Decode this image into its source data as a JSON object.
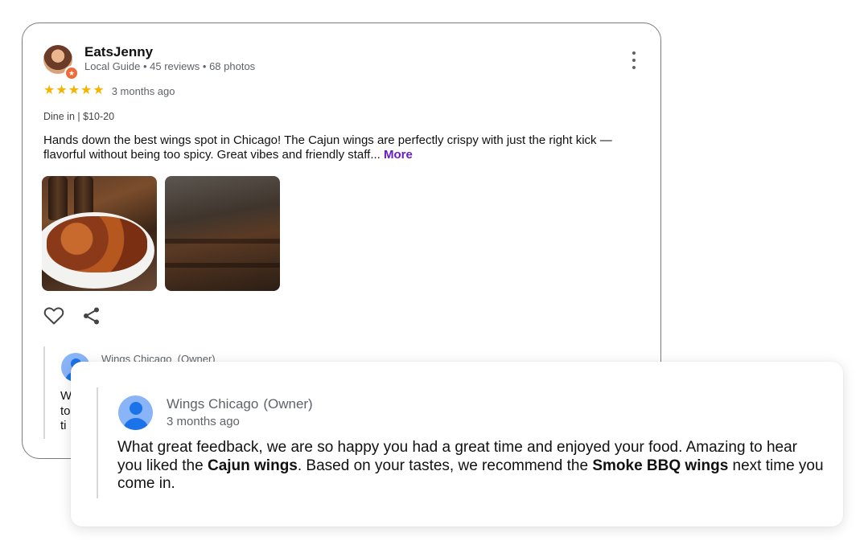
{
  "review": {
    "user_name": "EatsJenny",
    "user_meta": "Local Guide • 45 reviews • 68 photos",
    "rating": 5,
    "stars": [
      "★",
      "★",
      "★",
      "★",
      "★"
    ],
    "time": "3 months ago",
    "dine_info": "Dine in | $10-20",
    "text": "Hands down the best wings spot in Chicago! The Cajun wings are perfectly crispy with just the right kick — flavorful without being too spicy. Great vibes and friendly staff...",
    "more_label": "More",
    "photos": [
      "wings-photo",
      "restaurant-interior-photo"
    ],
    "icons": [
      "kebab-menu-icon",
      "heart-icon",
      "share-icon"
    ]
  },
  "owner_reply_preview": {
    "owner_name": "Wings Chicago",
    "owner_tag": "(Owner)",
    "visible_letters": [
      "W",
      "to",
      "ti"
    ]
  },
  "owner_reply": {
    "owner_name": "Wings Chicago",
    "owner_tag": "(Owner)",
    "time": "3 months ago",
    "text_1": "What great feedback, we are so happy you had a great time and enjoyed your food. Amazing to hear you liked the ",
    "bold_1": "Cajun wings",
    "text_2": ". Based on your tastes, we recommend the ",
    "bold_2": "Smoke BBQ wings",
    "text_3": " next time you come in."
  },
  "colors": {
    "star": "#f4b400",
    "more_link": "#6a1cc4",
    "avatar_blue": "#1a73e8",
    "avatar_bg": "#8ab4f8"
  }
}
